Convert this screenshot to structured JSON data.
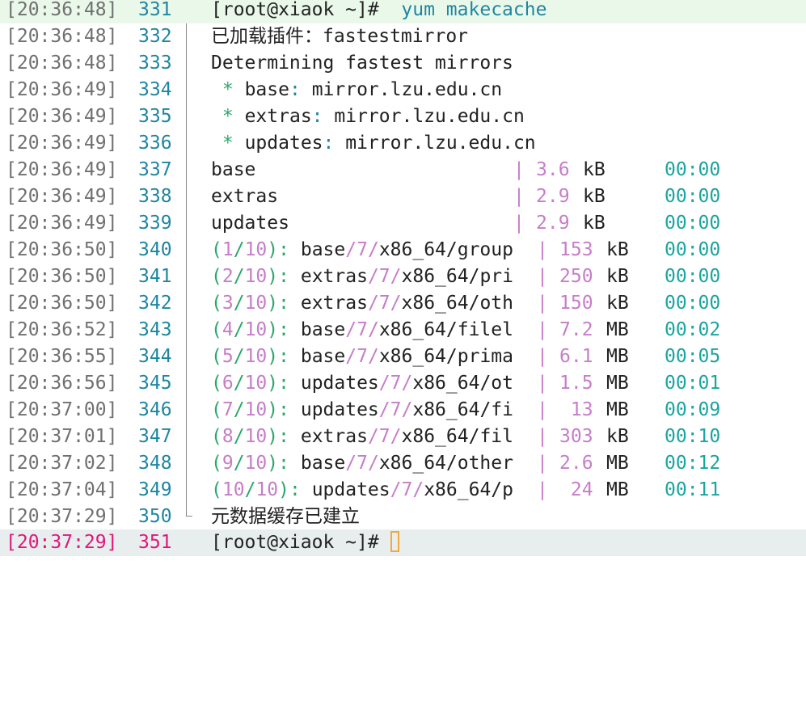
{
  "colors": {
    "timestamp": "#707070",
    "active": "#e0157a",
    "line_number": "#1f86a2",
    "accent_green": "#2aa86a",
    "number_purple": "#c77dc9",
    "time_teal": "#1aa5a0",
    "cursor": "#f2a93b"
  },
  "lines": [
    {
      "ts": "[20:36:48]",
      "ln": "331",
      "prompt": "[root@xiaok ~]#",
      "cmd": "yum makecache"
    },
    {
      "ts": "[20:36:48]",
      "ln": "332",
      "text": "已加载插件：fastestmirror"
    },
    {
      "ts": "[20:36:48]",
      "ln": "333",
      "text": "Determining fastest mirrors"
    },
    {
      "ts": "[20:36:49]",
      "ln": "334",
      "star": "*",
      "repo": "base",
      "colon": ":",
      "mirror": "mirror.lzu.edu.cn"
    },
    {
      "ts": "[20:36:49]",
      "ln": "335",
      "star": "*",
      "repo": "extras",
      "colon": ":",
      "mirror": "mirror.lzu.edu.cn"
    },
    {
      "ts": "[20:36:49]",
      "ln": "336",
      "star": "*",
      "repo": "updates",
      "colon": ":",
      "mirror": "mirror.lzu.edu.cn"
    },
    {
      "ts": "[20:36:49]",
      "ln": "337",
      "name": "base",
      "pipe": "|",
      "size": "3.6",
      "unit": "kB",
      "time": "00:00"
    },
    {
      "ts": "[20:36:49]",
      "ln": "338",
      "name": "extras",
      "pipe": "|",
      "size": "2.9",
      "unit": "kB",
      "time": "00:00"
    },
    {
      "ts": "[20:36:49]",
      "ln": "339",
      "name": "updates",
      "pipe": "|",
      "size": "2.9",
      "unit": "kB",
      "time": "00:00"
    },
    {
      "ts": "[20:36:50]",
      "ln": "340",
      "open": "(",
      "idx": "1",
      "slash": "/",
      "total": "10",
      "close": "):",
      "path_a": "base",
      "path_s1": "/",
      "path_v": "7",
      "path_s2": "/",
      "path_b": "x86_64/group",
      "pipe": "|",
      "size": "153",
      "unit": "kB",
      "time": "00:00"
    },
    {
      "ts": "[20:36:50]",
      "ln": "341",
      "open": "(",
      "idx": "2",
      "slash": "/",
      "total": "10",
      "close": "):",
      "path_a": "extras",
      "path_s1": "/",
      "path_v": "7",
      "path_s2": "/",
      "path_b": "x86_64/pri",
      "pipe": "|",
      "size": "250",
      "unit": "kB",
      "time": "00:00"
    },
    {
      "ts": "[20:36:50]",
      "ln": "342",
      "open": "(",
      "idx": "3",
      "slash": "/",
      "total": "10",
      "close": "):",
      "path_a": "extras",
      "path_s1": "/",
      "path_v": "7",
      "path_s2": "/",
      "path_b": "x86_64/oth",
      "pipe": "|",
      "size": "150",
      "unit": "kB",
      "time": "00:00"
    },
    {
      "ts": "[20:36:52]",
      "ln": "343",
      "open": "(",
      "idx": "4",
      "slash": "/",
      "total": "10",
      "close": "):",
      "path_a": "base",
      "path_s1": "/",
      "path_v": "7",
      "path_s2": "/",
      "path_b": "x86_64/filel",
      "pipe": "|",
      "size": "7.2",
      "unit": "MB",
      "time": "00:02"
    },
    {
      "ts": "[20:36:55]",
      "ln": "344",
      "open": "(",
      "idx": "5",
      "slash": "/",
      "total": "10",
      "close": "):",
      "path_a": "base",
      "path_s1": "/",
      "path_v": "7",
      "path_s2": "/",
      "path_b": "x86_64/prima",
      "pipe": "|",
      "size": "6.1",
      "unit": "MB",
      "time": "00:05"
    },
    {
      "ts": "[20:36:56]",
      "ln": "345",
      "open": "(",
      "idx": "6",
      "slash": "/",
      "total": "10",
      "close": "):",
      "path_a": "updates",
      "path_s1": "/",
      "path_v": "7",
      "path_s2": "/",
      "path_b": "x86_64/ot",
      "pipe": "|",
      "size": "1.5",
      "unit": "MB",
      "time": "00:01"
    },
    {
      "ts": "[20:37:00]",
      "ln": "346",
      "open": "(",
      "idx": "7",
      "slash": "/",
      "total": "10",
      "close": "):",
      "path_a": "updates",
      "path_s1": "/",
      "path_v": "7",
      "path_s2": "/",
      "path_b": "x86_64/fi",
      "pipe": "|",
      "size": " 13",
      "unit": "MB",
      "time": "00:09"
    },
    {
      "ts": "[20:37:01]",
      "ln": "347",
      "open": "(",
      "idx": "8",
      "slash": "/",
      "total": "10",
      "close": "):",
      "path_a": "extras",
      "path_s1": "/",
      "path_v": "7",
      "path_s2": "/",
      "path_b": "x86_64/fil",
      "pipe": "|",
      "size": "303",
      "unit": "kB",
      "time": "00:10"
    },
    {
      "ts": "[20:37:02]",
      "ln": "348",
      "open": "(",
      "idx": "9",
      "slash": "/",
      "total": "10",
      "close": "):",
      "path_a": "base",
      "path_s1": "/",
      "path_v": "7",
      "path_s2": "/",
      "path_b": "x86_64/other",
      "pipe": "|",
      "size": "2.6",
      "unit": "MB",
      "time": "00:12"
    },
    {
      "ts": "[20:37:04]",
      "ln": "349",
      "open": "(",
      "idx": "10",
      "slash": "/",
      "total": "10",
      "close": "):",
      "path_a": "updates",
      "path_s1": "/",
      "path_v": "7",
      "path_s2": "/",
      "path_b": "x86_64/p",
      "pipe": "|",
      "size": " 24",
      "unit": "MB",
      "time": "00:11"
    },
    {
      "ts": "[20:37:29]",
      "ln": "350",
      "text": "元数据缓存已建立"
    },
    {
      "ts": "[20:37:29]",
      "ln": "351",
      "prompt": "[root@xiaok ~]#",
      "cursor": true
    }
  ]
}
